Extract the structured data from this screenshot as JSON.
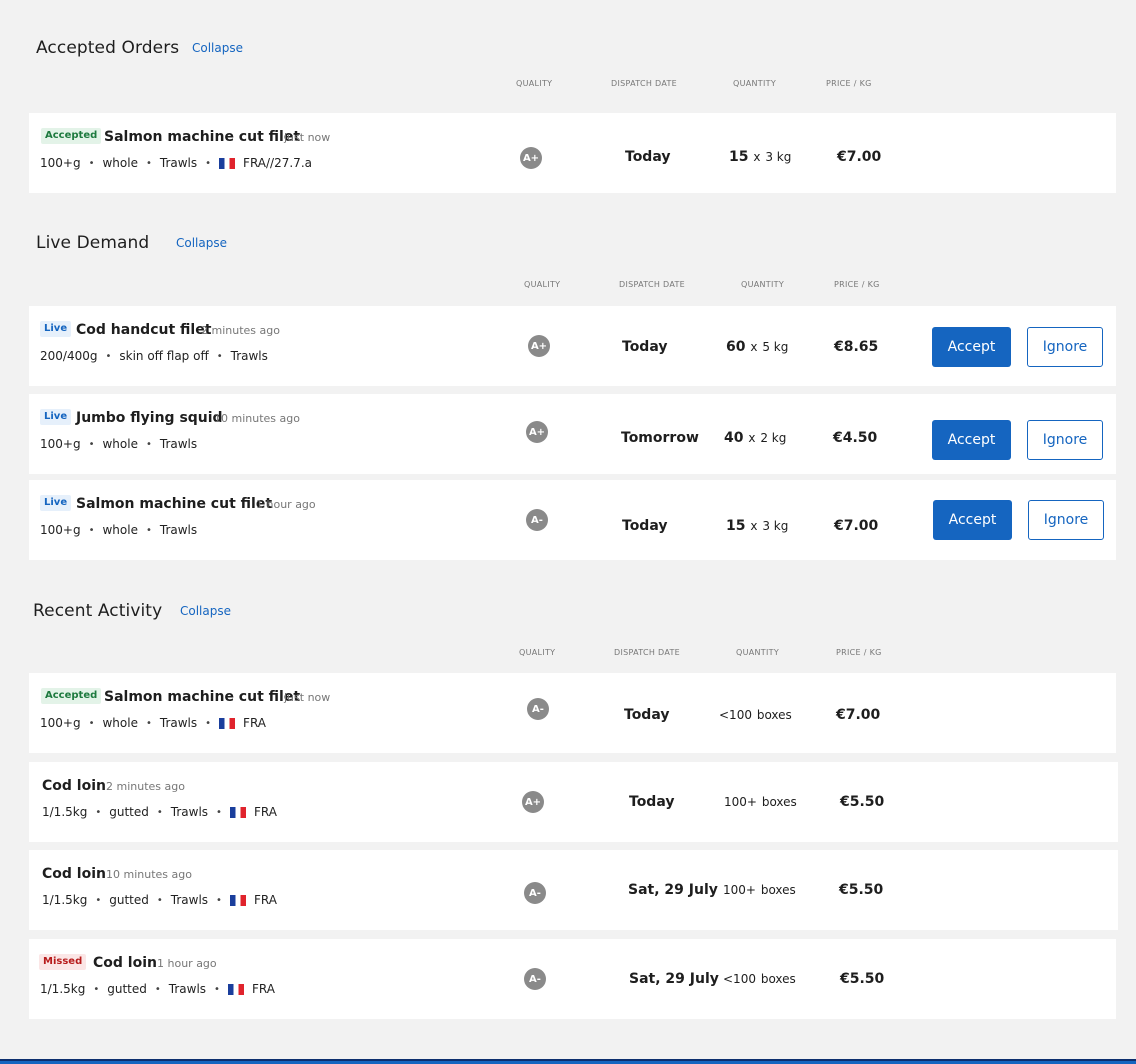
{
  "accepted": {
    "title": "Accepted Orders",
    "collapse": "Collapse",
    "headers": {
      "quality": "QUALITY",
      "dispatch": "DISPATCH DATE",
      "quantity": "QUANTITY",
      "price": "PRICE / KG"
    },
    "rows": [
      {
        "badge": "Accepted",
        "name": "Salmon machine cut filet",
        "time": "just now",
        "d1": "100+g",
        "d2": "whole",
        "d3": "Trawls",
        "origin": "FRA//27.7.a",
        "grade": "A+",
        "dispatch": "Today",
        "qty_n": "15",
        "qty_x": "x",
        "qty_u": "3 kg",
        "price": "€7.00"
      }
    ]
  },
  "live": {
    "title": "Live Demand",
    "collapse": "Collapse",
    "headers": {
      "quality": "QUALITY",
      "dispatch": "DISPATCH DATE",
      "quantity": "QUANTITY",
      "price": "PRICE / KG"
    },
    "accept_label": "Accept",
    "ignore_label": "Ignore",
    "rows": [
      {
        "badge": "Live",
        "name": "Cod handcut filet",
        "time": "2 minutes ago",
        "d1": "200/400g",
        "d2": "skin off flap off",
        "d3": "Trawls",
        "grade": "A+",
        "dispatch": "Today",
        "qty_n": "60",
        "qty_x": "x",
        "qty_u": "5 kg",
        "price": "€8.65"
      },
      {
        "badge": "Live",
        "name": "Jumbo flying squid",
        "time": "10 minutes ago",
        "d1": "100+g",
        "d2": "whole",
        "d3": "Trawls",
        "grade": "A+",
        "dispatch": "Tomorrow",
        "qty_n": "40",
        "qty_x": "x",
        "qty_u": "2 kg",
        "price": "€4.50"
      },
      {
        "badge": "Live",
        "name": "Salmon machine cut filet",
        "time": "1 hour ago",
        "d1": "100+g",
        "d2": "whole",
        "d3": "Trawls",
        "grade": "A-",
        "dispatch": "Today",
        "qty_n": "15",
        "qty_x": "x",
        "qty_u": "3 kg",
        "price": "€7.00"
      }
    ]
  },
  "recent": {
    "title": "Recent Activity",
    "collapse": "Collapse",
    "headers": {
      "quality": "QUALITY",
      "dispatch": "DISPATCH DATE",
      "quantity": "QUANTITY",
      "price": "PRICE / KG"
    },
    "rows": [
      {
        "badge": "Accepted",
        "name": "Salmon machine cut filet",
        "time": "just now",
        "d1": "100+g",
        "d2": "whole",
        "d3": "Trawls",
        "origin": "FRA",
        "grade": "A-",
        "dispatch": "Today",
        "qty_n": "<100",
        "qty_u": "boxes",
        "price": "€7.00"
      },
      {
        "name": "Cod loin",
        "time": "2 minutes ago",
        "d1": "1/1.5kg",
        "d2": "gutted",
        "d3": "Trawls",
        "origin": "FRA",
        "grade": "A+",
        "dispatch": "Today",
        "qty_n": "100+",
        "qty_u": "boxes",
        "price": "€5.50"
      },
      {
        "name": "Cod loin",
        "time": "10 minutes ago",
        "d1": "1/1.5kg",
        "d2": "gutted",
        "d3": "Trawls",
        "origin": "FRA",
        "grade": "A-",
        "dispatch": "Sat, 29 July",
        "qty_n": "100+",
        "qty_u": "boxes",
        "price": "€5.50"
      },
      {
        "badge": "Missed",
        "name": "Cod loin",
        "time": "1 hour ago",
        "d1": "1/1.5kg",
        "d2": "gutted",
        "d3": "Trawls",
        "origin": "FRA",
        "grade": "A-",
        "dispatch": "Sat, 29 July",
        "qty_n": "<100",
        "qty_u": "boxes",
        "price": "€5.50"
      }
    ]
  },
  "colors": {
    "accent": "#1565c0",
    "background": "#f2f2f2",
    "accepted_badge": "#1e7a3f",
    "live_badge": "#1565c0",
    "missed_badge": "#b71c1c",
    "grade_circle": "#8a8a8a"
  },
  "icons": {
    "flag": "france-flag-icon",
    "grade": "grade-circle-icon"
  }
}
